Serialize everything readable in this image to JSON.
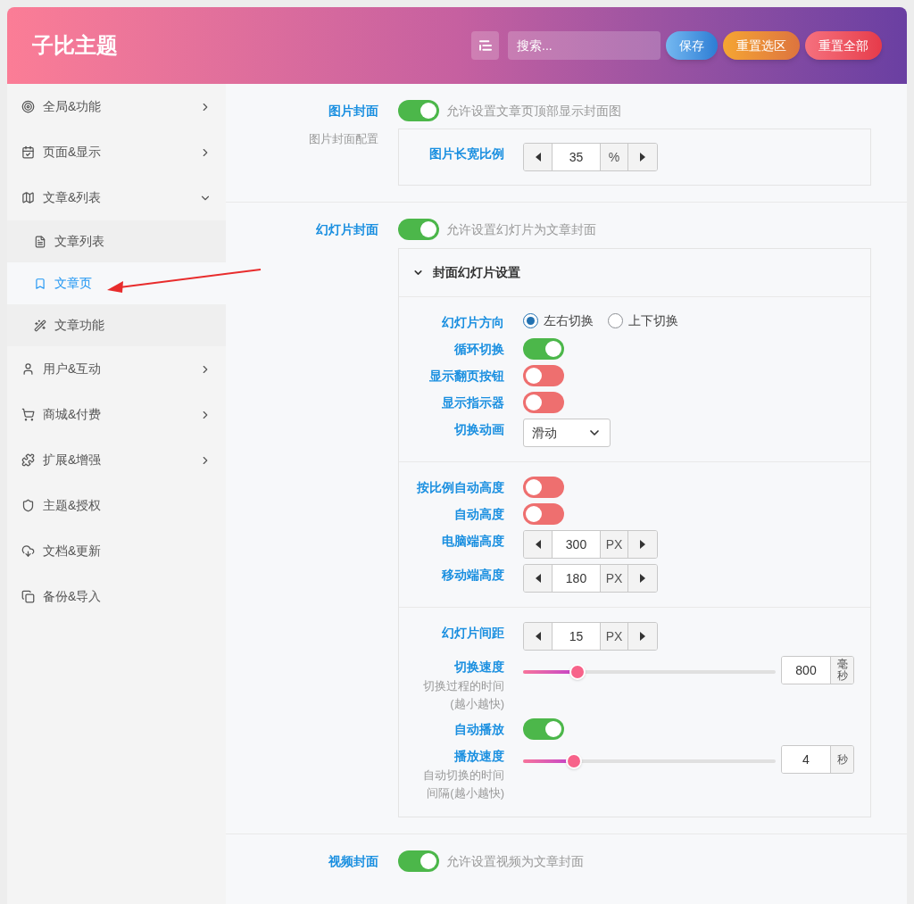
{
  "header": {
    "title": "子比主题",
    "search_placeholder": "搜索...",
    "buttons": [
      {
        "label": "保存",
        "kind": "save"
      },
      {
        "label": "重置选区",
        "kind": "reset_section"
      },
      {
        "label": "重置全部",
        "kind": "reset_all"
      }
    ]
  },
  "sidebar": {
    "items": [
      {
        "label": "全局&功能",
        "expanded": false,
        "has_children": true
      },
      {
        "label": "页面&显示",
        "expanded": false,
        "has_children": true
      },
      {
        "label": "文章&列表",
        "expanded": true,
        "has_children": true,
        "children": [
          {
            "label": "文章列表",
            "selected": false
          },
          {
            "label": "文章页",
            "selected": true
          },
          {
            "label": "文章功能",
            "selected": false
          }
        ]
      },
      {
        "label": "用户&互动",
        "expanded": false,
        "has_children": true
      },
      {
        "label": "商城&付费",
        "expanded": false,
        "has_children": true
      },
      {
        "label": "扩展&增强",
        "expanded": false,
        "has_children": true
      },
      {
        "label": "主题&授权",
        "has_children": false
      },
      {
        "label": "文档&更新",
        "has_children": false
      },
      {
        "label": "备份&导入",
        "has_children": false
      }
    ]
  },
  "sections": [
    {
      "label": "图片封面",
      "on": true,
      "description": "允许设置文章页顶部显示封面图",
      "sub": {
        "label": "图片封面配置",
        "fields": [
          {
            "kind": "stepper",
            "label": "图片长宽比例",
            "value": "35",
            "unit": "%"
          }
        ]
      }
    },
    {
      "label": "幻灯片封面",
      "on": true,
      "description": "允许设置幻灯片为文章封面",
      "group": {
        "title": "封面幻灯片设置",
        "expanded": true,
        "blocks": [
          [
            {
              "kind": "radio",
              "label": "幻灯片方向",
              "options": [
                {
                  "label": "左右切换",
                  "selected": true
                },
                {
                  "label": "上下切换",
                  "selected": false
                }
              ]
            },
            {
              "kind": "toggle",
              "label": "循环切换",
              "on": true
            },
            {
              "kind": "toggle",
              "label": "显示翻页按钮",
              "on": false
            },
            {
              "kind": "toggle",
              "label": "显示指示器",
              "on": false
            },
            {
              "kind": "select",
              "label": "切换动画",
              "value": "滑动"
            }
          ],
          [
            {
              "kind": "toggle",
              "label": "按比例自动高度",
              "on": false
            },
            {
              "kind": "toggle",
              "label": "自动高度",
              "on": false
            },
            {
              "kind": "stepper",
              "label": "电脑端高度",
              "value": "300",
              "unit": "PX"
            },
            {
              "kind": "stepper",
              "label": "移动端高度",
              "value": "180",
              "unit": "PX"
            }
          ],
          [
            {
              "kind": "stepper",
              "label": "幻灯片间距",
              "value": "15",
              "unit": "PX"
            },
            {
              "kind": "slider",
              "label": "切换速度",
              "hint_lines": [
                "切换过程的时间",
                "(越小越快)"
              ],
              "level": 0.215,
              "value": "800",
              "unit": "毫秒"
            },
            {
              "kind": "toggle",
              "label": "自动播放",
              "on": true
            },
            {
              "kind": "slider",
              "label": "播放速度",
              "hint_lines": [
                "自动切换的时间",
                "间隔(越小越快)"
              ],
              "level": 0.2,
              "value": "4",
              "unit": "秒"
            }
          ]
        ]
      }
    },
    {
      "label": "视频封面",
      "on": true,
      "description": "允许设置视频为文章封面"
    }
  ]
}
